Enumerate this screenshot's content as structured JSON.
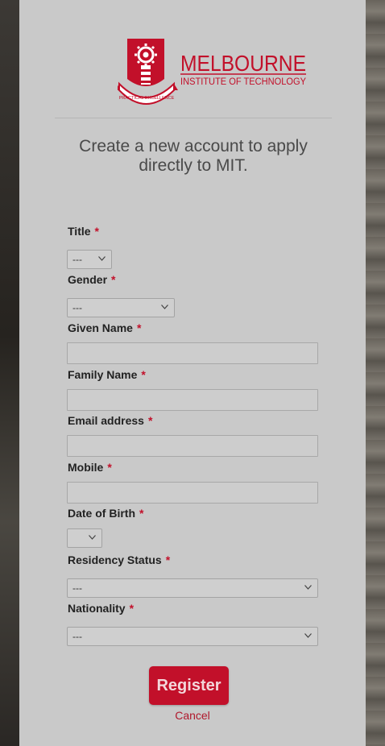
{
  "brand": {
    "name_line1": "MELBOURNE",
    "name_line2": "INSTITUTE OF TECHNOLOGY",
    "motto": "PRACTICAL EXCELLENCE",
    "color": "#c2102a"
  },
  "heading": "Create a new account to apply directly to MIT.",
  "required_marker": "*",
  "fields": {
    "title": {
      "label": "Title",
      "value": "---"
    },
    "gender": {
      "label": "Gender",
      "value": "---"
    },
    "given_name": {
      "label": "Given Name",
      "value": ""
    },
    "family_name": {
      "label": "Family Name",
      "value": ""
    },
    "email": {
      "label": "Email address",
      "value": ""
    },
    "mobile": {
      "label": "Mobile",
      "value": ""
    },
    "dob": {
      "label": "Date of Birth",
      "value": ""
    },
    "residency": {
      "label": "Residency Status",
      "value": "---"
    },
    "nationality": {
      "label": "Nationality",
      "value": "---"
    }
  },
  "actions": {
    "register": "Register",
    "cancel": "Cancel"
  }
}
